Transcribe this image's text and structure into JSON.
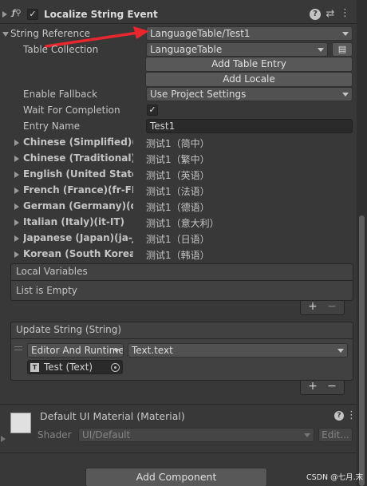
{
  "component": {
    "title": "Localize String Event",
    "fields": {
      "string_reference_label": "String Reference",
      "string_reference_value": "LanguageTable/Test1",
      "table_collection_label": "Table Collection",
      "table_collection_value": "LanguageTable",
      "add_table_entry": "Add Table Entry",
      "add_locale": "Add Locale",
      "enable_fallback_label": "Enable Fallback",
      "enable_fallback_value": "Use Project Settings",
      "wait_for_completion_label": "Wait For Completion",
      "entry_name_label": "Entry Name",
      "entry_name_value": "Test1"
    },
    "locales": [
      {
        "name": "Chinese (Simplified)(zh",
        "value": "测试1（简中）"
      },
      {
        "name": "Chinese (Traditional)(zl",
        "value": "测试1（繁中）"
      },
      {
        "name": "English (United States)",
        "value": "测试1（英语）"
      },
      {
        "name": "French (France)(fr-FR)",
        "value": "测试1（法语）"
      },
      {
        "name": "German (Germany)(de-",
        "value": "测试1（德语）"
      },
      {
        "name": "Italian (Italy)(it-IT)",
        "value": "测试1（意大利）"
      },
      {
        "name": "Japanese (Japan)(ja-JI",
        "value": "测试1（日语）"
      },
      {
        "name": "Korean (South Korea)(k",
        "value": "测试1（韩语）"
      }
    ],
    "local_variables": {
      "header": "Local Variables",
      "empty_text": "List is Empty"
    },
    "update_string": {
      "header": "Update String (String)",
      "runtime_value": "Editor And Runtime",
      "function_value": "Text.text",
      "object_value": "Test (Text)"
    }
  },
  "material": {
    "title": "Default UI Material (Material)",
    "shader_label": "Shader",
    "shader_value": "UI/Default",
    "edit_label": "Edit..."
  },
  "add_component_label": "Add Component",
  "watermark": "CSDN @七月.末",
  "colors": {
    "arrow": "#e8262d",
    "panel_bg": "#383838"
  },
  "icons": [
    "script-icon",
    "help-icon",
    "preset-icon",
    "kebab-icon",
    "picker-icon"
  ]
}
